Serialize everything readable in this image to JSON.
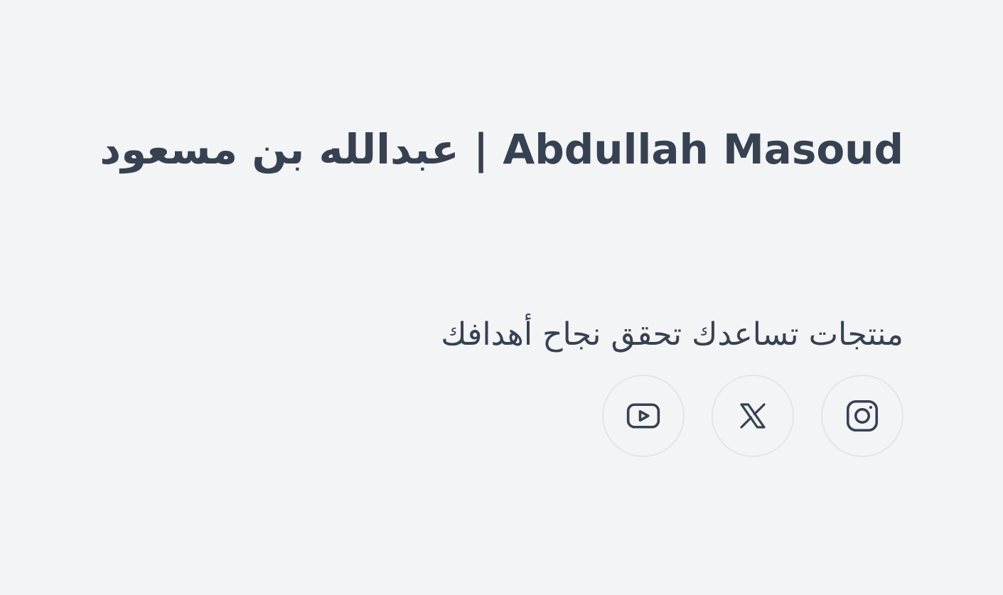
{
  "header": {
    "title": "Abdullah Masoud | عبدالله بن مسعود"
  },
  "hero": {
    "tagline": "منتجات تساعدك تحقق نجاح أهدافك"
  },
  "social": {
    "items": [
      {
        "name": "Instagram",
        "icon": "instagram-icon"
      },
      {
        "name": "X",
        "icon": "x-icon"
      },
      {
        "name": "YouTube",
        "icon": "youtube-icon"
      }
    ]
  },
  "colors": {
    "background": "#f3f4f6",
    "text": "#374151",
    "icon_border": "#e3e5e9"
  }
}
